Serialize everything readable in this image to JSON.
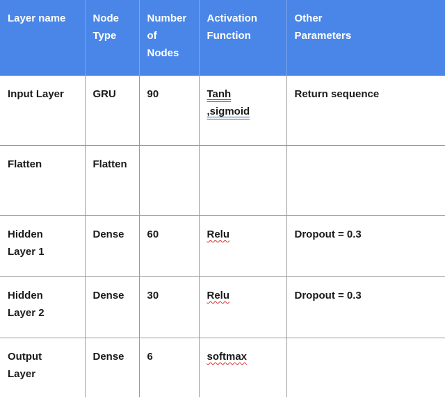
{
  "headers": {
    "layer_name": "Layer name",
    "node_type_1": "Node",
    "node_type_2": "Type",
    "number_1": "Number",
    "number_2": "of",
    "number_3": "Nodes",
    "activation_1": "Activation",
    "activation_2": "Function",
    "other_1": "Other",
    "other_2": "Parameters"
  },
  "rows": [
    {
      "layer_name": [
        "Input Layer"
      ],
      "node_type": "GRU",
      "nodes": "90",
      "activation": [
        "Tanh",
        ",sigmoid"
      ],
      "other": "Return sequence"
    },
    {
      "layer_name": [
        "Flatten"
      ],
      "node_type": "Flatten",
      "nodes": "",
      "activation": [
        ""
      ],
      "other": ""
    },
    {
      "layer_name": [
        "Hidden",
        "Layer 1"
      ],
      "node_type": "Dense",
      "nodes": "60",
      "activation": [
        "Relu"
      ],
      "other": "Dropout = 0.3"
    },
    {
      "layer_name": [
        "Hidden",
        "Layer 2"
      ],
      "node_type": "Dense",
      "nodes": "30",
      "activation": [
        "Relu"
      ],
      "other": "Dropout = 0.3"
    },
    {
      "layer_name": [
        "Output",
        "Layer"
      ],
      "node_type": "Dense",
      "nodes": "6",
      "activation": [
        "softmax"
      ],
      "other": ""
    }
  ],
  "colors": {
    "header_bg": "#4a86e8",
    "header_text": "#ffffff",
    "grid": "#9a9a9a"
  }
}
